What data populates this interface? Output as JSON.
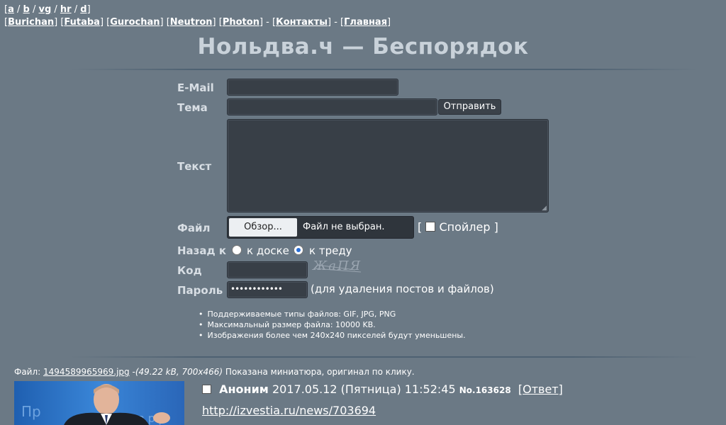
{
  "nav": {
    "boards": [
      "a",
      "b",
      "vg",
      "hr",
      "d"
    ],
    "styles": [
      "Burichan",
      "Futaba",
      "Gurochan",
      "Neutron",
      "Photon"
    ],
    "contacts": "Контакты",
    "home": "Главная"
  },
  "title": "Нольдва.ч — Беспорядок",
  "form": {
    "email_label": "E-Mail",
    "subject_label": "Тема",
    "submit": "Отправить",
    "text_label": "Текст",
    "file_label": "Файл",
    "file_button": "Обзор...",
    "file_status": "Файл не выбран.",
    "spoiler_open": "[",
    "spoiler_label": "Спойлер",
    "spoiler_close": "]",
    "back_label": "Назад к",
    "back_board": "к доске",
    "back_thread": "к треду",
    "back_selected": "к треду",
    "captcha_label": "Код",
    "captcha_text": "ЖаПЯ",
    "password_label": "Пароль",
    "password_value": "••••••••••••",
    "password_hint": "(для удаления постов и файлов)"
  },
  "rules": [
    "Поддерживаемые типы файлов: GIF, JPG, PNG",
    "Максимальный размер файла: 10000 KB.",
    "Изображения более чем 240x240 пикселей будут уменьшены."
  ],
  "post": {
    "file_prefix": "Файл:",
    "file_name": "1494589965969.jpg",
    "file_meta": "(49.22 kB, 700x466)",
    "file_note": "Показана миниатюра, оригинал по клику.",
    "author": "Аноним",
    "date": "2017.05.12 (Пятница) 11:52:45",
    "number": "No.163628",
    "reply": "Ответ",
    "link": "http://izvestia.ru/news/703694"
  }
}
